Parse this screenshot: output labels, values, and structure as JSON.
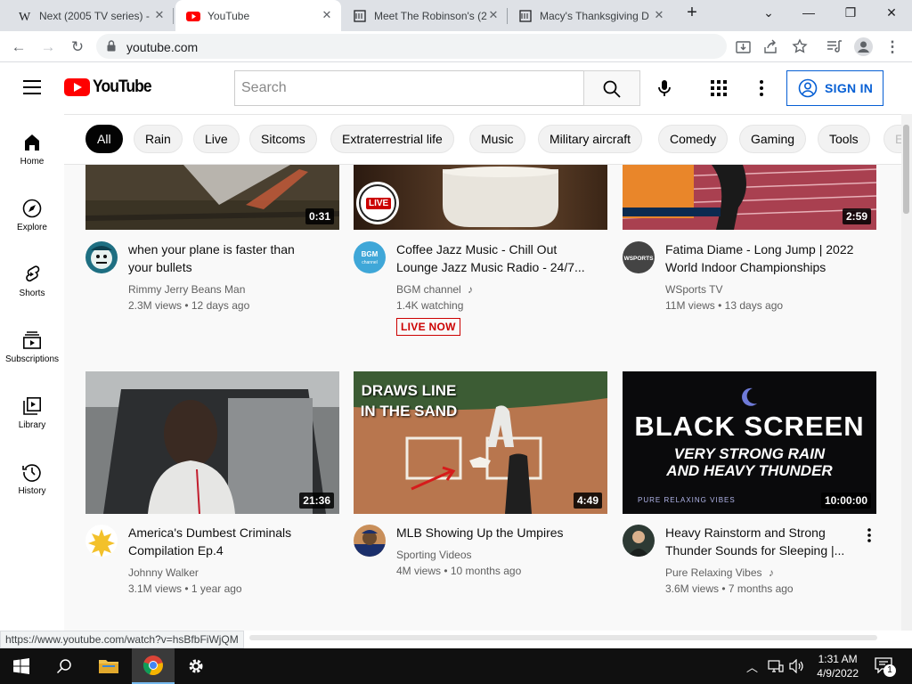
{
  "browser": {
    "tabs": [
      {
        "title": "Next (2005 TV series) -",
        "favicon": "wikipedia-icon"
      },
      {
        "title": "YouTube",
        "favicon": "youtube-icon"
      },
      {
        "title": "Meet The Robinson's (2",
        "favicon": "page-icon"
      },
      {
        "title": "Macy's Thanksgiving D",
        "favicon": "page-icon"
      }
    ],
    "active_tab": 1,
    "url": "youtube.com"
  },
  "header": {
    "logo_text": "YouTube",
    "search_placeholder": "Search",
    "signin_label": "SIGN IN"
  },
  "sidebar": {
    "items": [
      {
        "label": "Home",
        "icon": "home-icon"
      },
      {
        "label": "Explore",
        "icon": "compass-icon"
      },
      {
        "label": "Shorts",
        "icon": "shorts-icon"
      },
      {
        "label": "Subscriptions",
        "icon": "subscriptions-icon"
      },
      {
        "label": "Library",
        "icon": "library-icon"
      },
      {
        "label": "History",
        "icon": "history-icon"
      }
    ]
  },
  "chips": [
    "All",
    "Rain",
    "Live",
    "Sitcoms",
    "Extraterrestrial life",
    "Music",
    "Military aircraft",
    "Comedy",
    "Gaming",
    "Tools",
    "E"
  ],
  "videos": [
    {
      "title_line1": "when your plane is faster than",
      "title_line2": "your bullets",
      "channel": "Rimmy Jerry Beans Man",
      "meta": "2.3M views • 12 days ago",
      "duration": "0:31"
    },
    {
      "title_line1": "Coffee Jazz Music - Chill Out",
      "title_line2": "Lounge Jazz Music Radio - 24/7...",
      "channel": "BGM channel",
      "meta": "1.4K watching",
      "badge": "LIVE NOW",
      "thumb_label": "LIVE"
    },
    {
      "title_line1": "Fatima Diame - Long Jump | 2022",
      "title_line2": "World Indoor Championships",
      "channel": "WSports TV",
      "meta": "11M views • 13 days ago",
      "duration": "2:59"
    },
    {
      "title_line1": "America's Dumbest Criminals",
      "title_line2": "Compilation Ep.4",
      "channel": "Johnny Walker",
      "meta": "3.1M views • 1 year ago",
      "duration": "21:36"
    },
    {
      "title_line1": "MLB Showing Up the Umpires",
      "title_line2": "",
      "channel": "Sporting Videos",
      "meta": "4M views • 10 months ago",
      "duration": "4:49",
      "thumb_text": "DRAWS LINE IN THE SAND"
    },
    {
      "title_line1": "Heavy Rainstorm and Strong",
      "title_line2": "Thunder Sounds for Sleeping |...",
      "channel": "Pure Relaxing Vibes",
      "meta": "3.6M views • 7 months ago",
      "duration": "10:00:00",
      "thumb_line1": "BLACK SCREEN",
      "thumb_line2": "VERY STRONG RAIN",
      "thumb_line3": "AND HEAVY THUNDER",
      "thumb_line4": "PURE RELAXING VIBES"
    }
  ],
  "status_url": "https://www.youtube.com/watch?v=hsBfbFiWjQM",
  "taskbar": {
    "time": "1:31 AM",
    "date": "4/9/2022",
    "notification_count": "1"
  }
}
